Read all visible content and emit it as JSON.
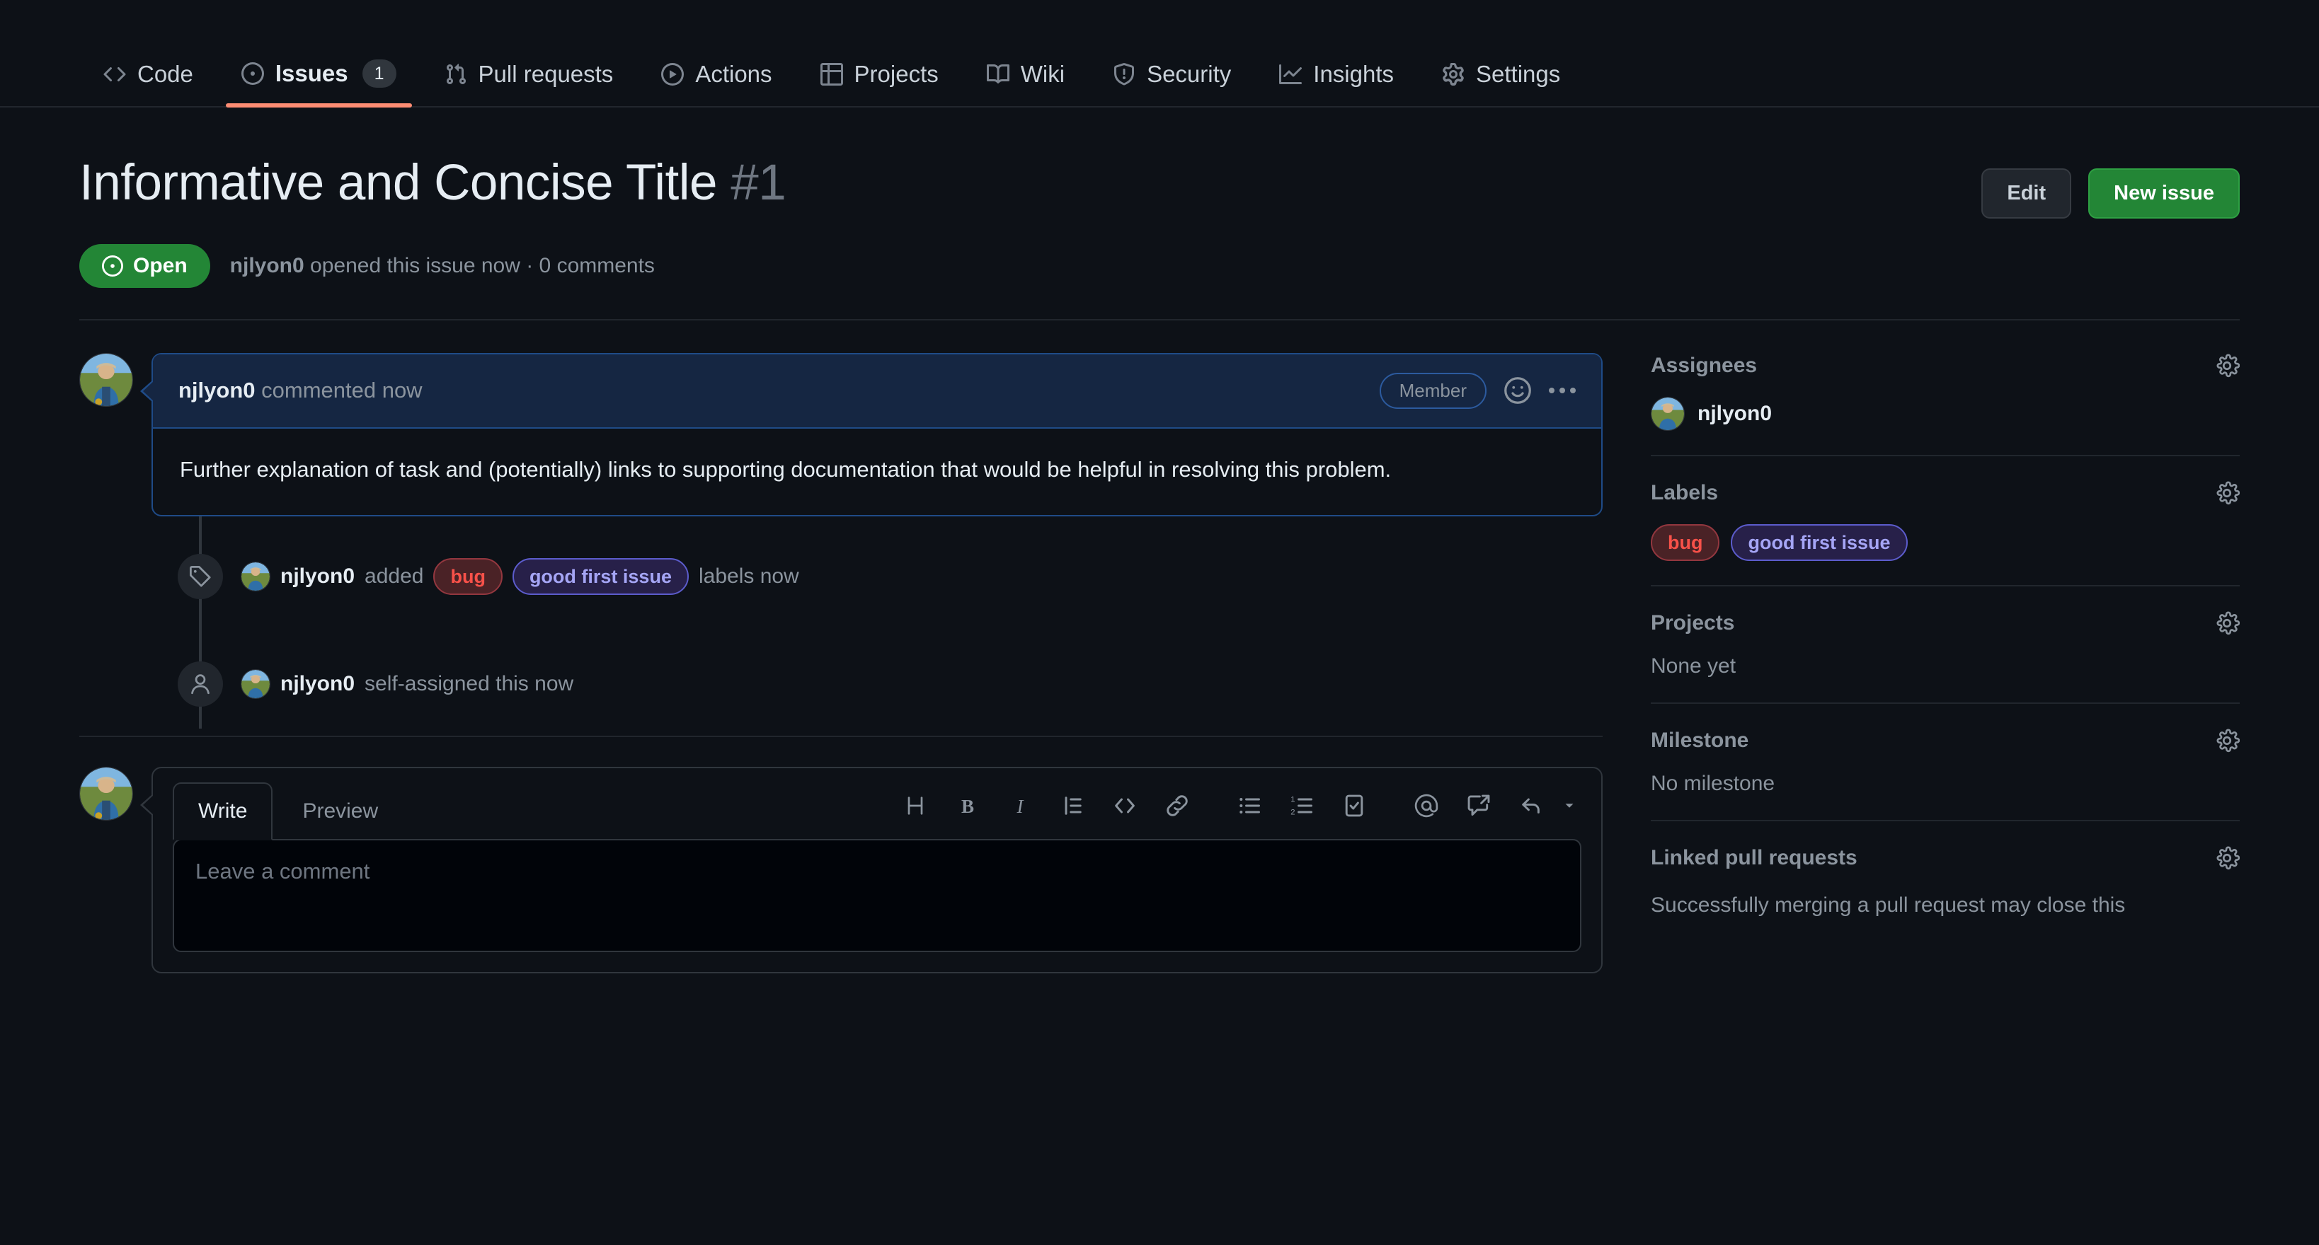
{
  "repo_nav": {
    "items": [
      {
        "label": "Code",
        "icon": "code-icon",
        "active": false,
        "count": null
      },
      {
        "label": "Issues",
        "icon": "issue-opened-icon",
        "active": true,
        "count": "1"
      },
      {
        "label": "Pull requests",
        "icon": "git-pull-request-icon",
        "active": false,
        "count": null
      },
      {
        "label": "Actions",
        "icon": "play-icon",
        "active": false,
        "count": null
      },
      {
        "label": "Projects",
        "icon": "table-icon",
        "active": false,
        "count": null
      },
      {
        "label": "Wiki",
        "icon": "book-icon",
        "active": false,
        "count": null
      },
      {
        "label": "Security",
        "icon": "shield-icon",
        "active": false,
        "count": null
      },
      {
        "label": "Insights",
        "icon": "graph-icon",
        "active": false,
        "count": null
      },
      {
        "label": "Settings",
        "icon": "gear-icon",
        "active": false,
        "count": null
      }
    ],
    "active_underline_color": "#fd8c73"
  },
  "issue": {
    "title": "Informative and Concise Title",
    "number": "#1",
    "state_label": "Open",
    "state_color": "#238636",
    "meta_author": "njlyon0",
    "meta_rest": " opened this issue now · 0 comments",
    "edit_label": "Edit",
    "new_issue_label": "New issue"
  },
  "comment": {
    "author": "njlyon0",
    "action": " commented now",
    "role_badge": "Member",
    "body": "Further explanation of task and (potentially) links to supporting documentation that would be helpful in resolving this problem.",
    "emoji_icon": "smiley-icon",
    "menu_icon": "kebab-horizontal-icon"
  },
  "timeline": [
    {
      "icon": "tag-icon",
      "actor": "njlyon0",
      "verb": " added ",
      "labels": [
        {
          "text": "bug",
          "color": "#f85149",
          "bg": "#4a2226",
          "border": "#93373f"
        },
        {
          "text": "good first issue",
          "color": "#a5a5f5",
          "bg": "#272049",
          "border": "#5c5ccc"
        }
      ],
      "suffix": " labels now"
    },
    {
      "icon": "person-icon",
      "actor": "njlyon0",
      "verb": " self-assigned this now",
      "labels": [],
      "suffix": ""
    }
  ],
  "comment_form": {
    "tabs": [
      {
        "label": "Write",
        "active": true
      },
      {
        "label": "Preview",
        "active": false
      }
    ],
    "toolbar": [
      {
        "name": "heading-icon",
        "glyph": "H"
      },
      {
        "name": "bold-icon",
        "glyph": "B"
      },
      {
        "name": "italic-icon",
        "glyph": "I"
      },
      {
        "name": "quote-icon",
        "glyph": ""
      },
      {
        "name": "code-icon",
        "glyph": ""
      },
      {
        "name": "link-icon",
        "glyph": ""
      },
      {
        "name": "unordered-list-icon",
        "glyph": ""
      },
      {
        "name": "ordered-list-icon",
        "glyph": ""
      },
      {
        "name": "task-list-icon",
        "glyph": ""
      },
      {
        "name": "mention-icon",
        "glyph": ""
      },
      {
        "name": "cross-reference-icon",
        "glyph": ""
      },
      {
        "name": "saved-reply-icon",
        "glyph": ""
      }
    ],
    "placeholder": "Leave a comment"
  },
  "sidebar": {
    "assignees": {
      "title": "Assignees",
      "user": "njlyon0"
    },
    "labels": {
      "title": "Labels",
      "items": [
        {
          "text": "bug",
          "color": "#f85149",
          "bg": "#4a2226",
          "border": "#93373f"
        },
        {
          "text": "good first issue",
          "color": "#a5a5f5",
          "bg": "#272049",
          "border": "#5c5ccc"
        }
      ]
    },
    "projects": {
      "title": "Projects",
      "value": "None yet"
    },
    "milestone": {
      "title": "Milestone",
      "value": "No milestone"
    },
    "linked_prs": {
      "title": "Linked pull requests",
      "value": "Successfully merging a pull request may close this"
    },
    "gear_icon": "gear-icon"
  }
}
